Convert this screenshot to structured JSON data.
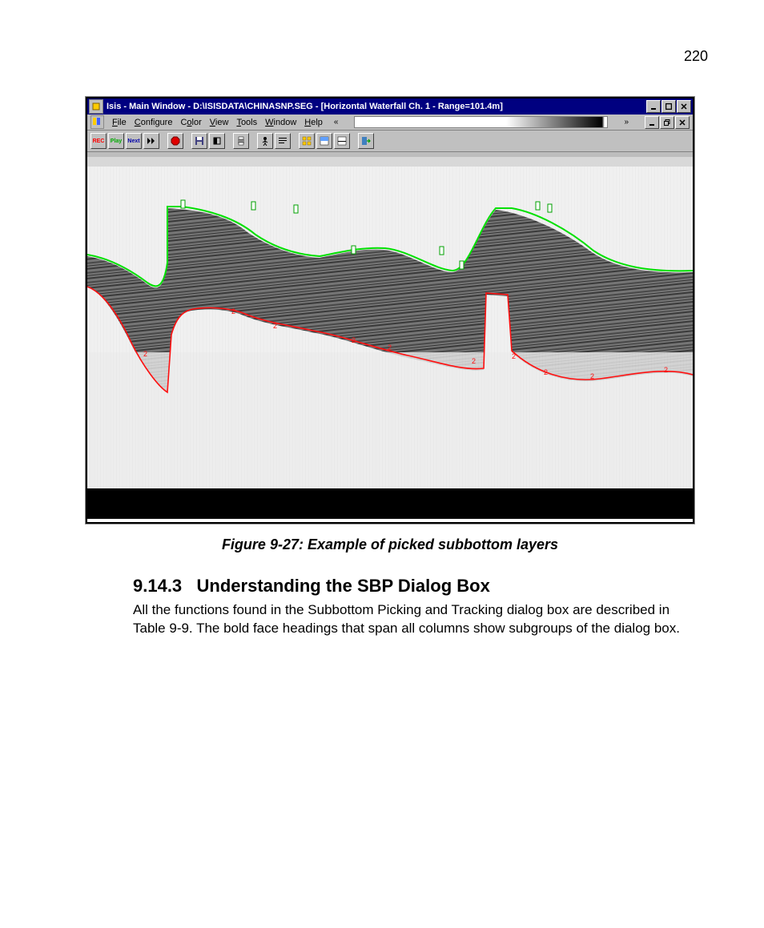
{
  "page": {
    "number": "220"
  },
  "appwindow": {
    "title": "Isis - Main Window - D:\\ISISDATA\\CHINASNP.SEG - [Horizontal Waterfall Ch. 1 - Range=101.4m]",
    "menu": {
      "file": "File",
      "configure": "Configure",
      "color": "Color",
      "view": "View",
      "tools": "Tools",
      "window": "Window",
      "help": "Help",
      "chev_left": "«",
      "chev_right": "»"
    },
    "toolbar": {
      "rec": "REC",
      "play": "Play",
      "next": "Next"
    }
  },
  "figure": {
    "caption": "Figure 9-27: Example of picked subbottom layers"
  },
  "section": {
    "number": "9.14.3",
    "title": "Understanding the SBP Dialog Box",
    "body": "All the functions found in the Subbottom Picking and Tracking dialog box are described in Table 9-9. The bold face headings that span all columns show subgroups of the dialog box."
  }
}
